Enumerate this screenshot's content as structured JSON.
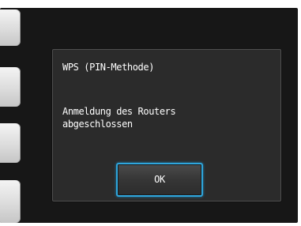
{
  "dialog": {
    "title": "WPS (PIN-Methode)",
    "message_lines": [
      "Anmeldung des Routers",
      "abgeschlossen"
    ],
    "ok_label": "OK"
  },
  "colors": {
    "screen_background": "#171717",
    "dialog_background": "#2b2b2b",
    "button_focus_border": "#2fa6dc",
    "text": "#ffffff"
  }
}
